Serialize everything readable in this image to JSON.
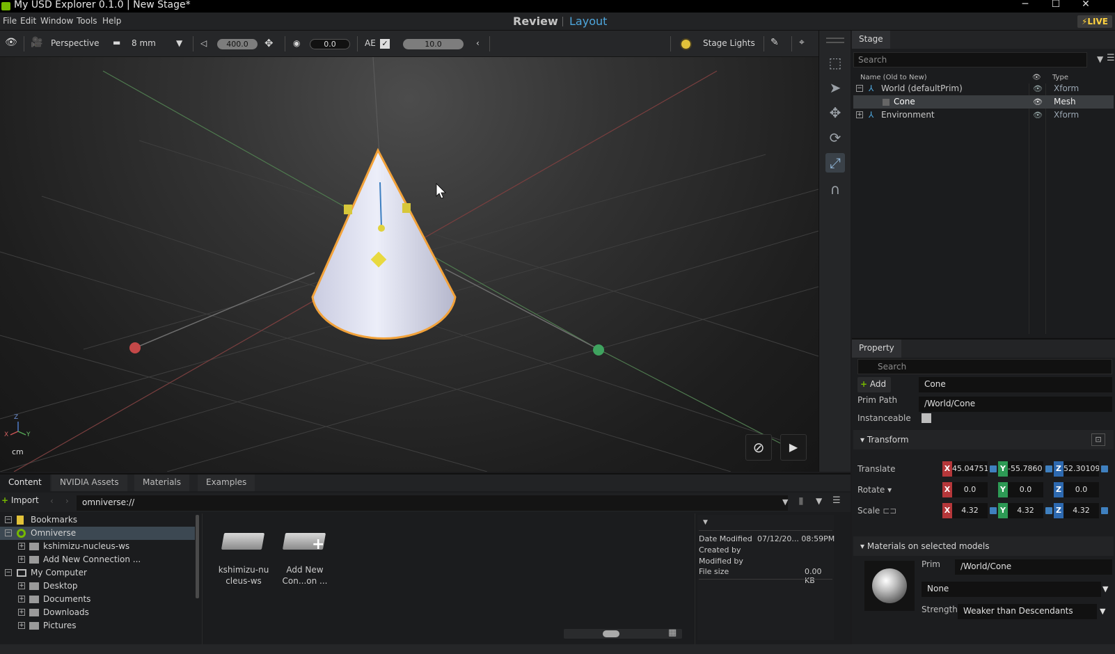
{
  "window": {
    "title": "My USD Explorer 0.1.0 | New Stage*",
    "minimize": "─",
    "maximize": "☐",
    "close": "✕"
  },
  "menu": [
    "File",
    "Edit",
    "Window",
    "Tools",
    "Help"
  ],
  "modes": {
    "review": "Review",
    "layout": "Layout",
    "live": "⚡LIVE"
  },
  "viewport_toolbar": {
    "camera": "Perspective",
    "lens": "8 mm",
    "speed": "400.0",
    "exposure_value": "0.0",
    "ae_label": "AE",
    "ae_value": "10.0",
    "stage_lights": "Stage Lights"
  },
  "viewport": {
    "units": "cm",
    "gizmo_axes": [
      "Z",
      "X",
      "Y"
    ]
  },
  "stage": {
    "tab": "Stage",
    "search_placeholder": "Search",
    "columns": {
      "name": "Name (Old to New)",
      "type": "Type"
    },
    "rows": [
      {
        "name": "World (defaultPrim)",
        "type": "Xform",
        "expand": "−"
      },
      {
        "name": "Cone",
        "type": "Mesh",
        "expand": ""
      },
      {
        "name": "Environment",
        "type": "Xform",
        "expand": "+"
      }
    ]
  },
  "property": {
    "tab": "Property",
    "search_placeholder": "Search",
    "add_label": "Add",
    "name_value": "Cone",
    "prim_path_label": "Prim Path",
    "prim_path_value": "/World/Cone",
    "instanceable_label": "Instanceable",
    "transform_section": "Transform",
    "translate_label": "Translate",
    "rotate_label": "Rotate",
    "scale_label": "Scale",
    "translate": {
      "x": "45.04751",
      "y": "-55.7860",
      "z": "52.30109"
    },
    "rotate": {
      "x": "0.0",
      "y": "0.0",
      "z": "0.0"
    },
    "scale": {
      "x": "4.32",
      "y": "4.32",
      "z": "4.32"
    },
    "materials_section": "Materials on selected models",
    "prim_label": "Prim",
    "prim_value": "/World/Cone",
    "material_value": "None",
    "strength_label": "Strength",
    "strength_value": "Weaker than Descendants"
  },
  "content": {
    "tabs": [
      "Content",
      "NVIDIA Assets",
      "Materials",
      "Examples"
    ],
    "import_label": "Import",
    "path": "omniverse://",
    "tree": [
      {
        "label": "Bookmarks",
        "indent": 0,
        "expand": "−"
      },
      {
        "label": "Omniverse",
        "indent": 0,
        "expand": "−"
      },
      {
        "label": "kshimizu-nucleus-ws",
        "indent": 1,
        "expand": "+"
      },
      {
        "label": "Add New Connection ...",
        "indent": 1,
        "expand": "+"
      },
      {
        "label": "My Computer",
        "indent": 0,
        "expand": "−"
      },
      {
        "label": "Desktop",
        "indent": 1,
        "expand": "+"
      },
      {
        "label": "Documents",
        "indent": 1,
        "expand": "+"
      },
      {
        "label": "Downloads",
        "indent": 1,
        "expand": "+"
      },
      {
        "label": "Pictures",
        "indent": 1,
        "expand": "+"
      }
    ],
    "grid_items": [
      {
        "line1": "kshimizu-nu",
        "line2": "cleus-ws"
      },
      {
        "line1": "Add New",
        "line2": "Con...on ..."
      }
    ],
    "details": {
      "date_modified_label": "Date Modified",
      "date_modified_value": "07/12/20... 08:59PM",
      "created_by_label": "Created by",
      "modified_by_label": "Modified by",
      "file_size_label": "File size",
      "file_size_value": "0.00 KB"
    }
  },
  "colors": {
    "accent": "#4ea6dc",
    "selection_outline": "#f2a23a",
    "live": "#ffd23f"
  }
}
